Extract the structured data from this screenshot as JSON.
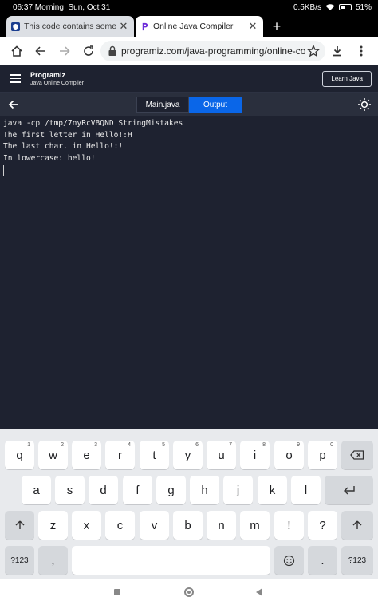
{
  "status_bar": {
    "time": "06:37 Morning",
    "date": "Sun, Oct 31",
    "network_speed": "0.5KB/s",
    "battery": "51%",
    "battery_level": 0.51
  },
  "browser": {
    "tabs": [
      {
        "title": "This code contains some co",
        "active": false
      },
      {
        "title": "Online Java Compiler",
        "active": true
      }
    ],
    "new_tab": "+",
    "address": "programiz.com/java-programming/online-compi"
  },
  "site": {
    "logo_text": "Programiz",
    "subtitle": "Java Online Compiler",
    "learn_button": "Learn Java"
  },
  "editor": {
    "tabs": [
      {
        "label": "Main.java",
        "active": false
      },
      {
        "label": "Output",
        "active": true
      }
    ]
  },
  "console": {
    "lines": [
      "java -cp /tmp/7nyRcVBQND StringMistakes",
      "The first letter in Hello!:H",
      "The last char. in Hello!:!",
      "In lowercase: hello!"
    ]
  },
  "keyboard": {
    "row1": [
      {
        "key": "q",
        "hint": "1"
      },
      {
        "key": "w",
        "hint": "2"
      },
      {
        "key": "e",
        "hint": "3"
      },
      {
        "key": "r",
        "hint": "4"
      },
      {
        "key": "t",
        "hint": "5"
      },
      {
        "key": "y",
        "hint": "6"
      },
      {
        "key": "u",
        "hint": "7"
      },
      {
        "key": "i",
        "hint": "8"
      },
      {
        "key": "o",
        "hint": "9"
      },
      {
        "key": "p",
        "hint": "0"
      }
    ],
    "row2": [
      "a",
      "s",
      "d",
      "f",
      "g",
      "h",
      "j",
      "k",
      "l"
    ],
    "row3": [
      "z",
      "x",
      "c",
      "v",
      "b",
      "n",
      "m",
      "!",
      "?"
    ],
    "symbols_key": "?123",
    "comma_key": ",",
    "period_key": "."
  }
}
